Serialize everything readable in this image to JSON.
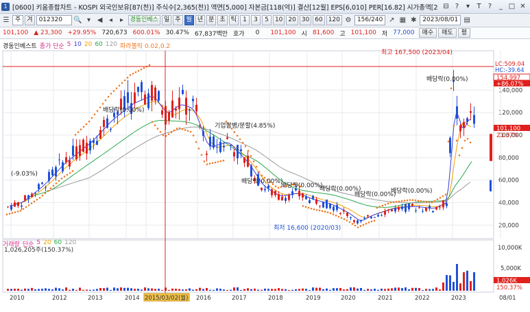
{
  "window": {
    "title": "[0600] 키움종합차트 - KOSPI 외국인보유[87(천)] 주식수[2,365(천)] 액면[5,000] 자본금[118(억)] 결산[12월] EPS[6,010] PER[16.82] 시가총액[2",
    "icon_label": "1",
    "buttons": [
      "⊟",
      "?",
      "▾",
      "T",
      "?",
      "_",
      "□",
      "✕"
    ]
  },
  "toolbar": {
    "market": "주",
    "mode": "겨",
    "code": "012320",
    "company": "경동인베스",
    "period_buttons": [
      "일",
      "주",
      "월",
      "년",
      "분",
      "초",
      "틱"
    ],
    "active_period": "월",
    "interval_buttons": [
      "1",
      "3",
      "5",
      "10",
      "20",
      "30",
      "60",
      "120"
    ],
    "page_count": "156/240",
    "date": "2023/08/01"
  },
  "quote": {
    "price": "101,100",
    "change": "▲ 23,300",
    "change_pct": "+29.95%",
    "volume": "720,673",
    "vol_ratio": "600.01%",
    "turnover": "30.47%",
    "amount": "67,837백만",
    "hoga_label": "호가",
    "hoga_value": "0",
    "hoga_price": "101,100",
    "open_label": "시",
    "open": "81,600",
    "high_label": "고",
    "high": "101,100",
    "low_label": "저",
    "low": "77,000",
    "buy_button": "매수",
    "sell_button": "매도",
    "avg_button": "평"
  },
  "chart_data": {
    "type": "candlestick",
    "title": "경동인베스트",
    "indicators": {
      "ma_label": "종가 단순",
      "ma_periods": [
        "5",
        "10",
        "20",
        "60",
        "120"
      ],
      "ma_colors": [
        "#d42c8a",
        "#3b3bd8",
        "#f0a000",
        "#29a84a",
        "#9a9a9a"
      ],
      "parabolic": "파라볼릭 0.02,0.2"
    },
    "y_axis": {
      "ticks": [
        20000,
        40000,
        60000,
        80000,
        100000,
        120000,
        140000
      ],
      "tick_labels": [
        "20,000",
        "40,000",
        "60,000",
        "80,000",
        "100,000",
        "120,000",
        "140,000"
      ],
      "ylim": [
        8000,
        175000
      ]
    },
    "x_axis": {
      "tick_labels": [
        "2010",
        "2012",
        "2013",
        "2014",
        "2015/03/02(월)",
        "2016",
        "2017",
        "2018",
        "2019",
        "2020",
        "2021",
        "2022",
        "2023",
        "08/01"
      ]
    },
    "price_labels": {
      "lc": "LC:509.04",
      "hc": "HC:-39.64",
      "ref_price": "154,997",
      "ref_pct": "+86.07%",
      "cur_price": "101,100",
      "cur_pct": "21.37%"
    },
    "annotations": {
      "high": "최고 167,500 (2023/04)",
      "low": "최저 16,600 (2020/03)",
      "left": "(-9.03%)",
      "merge": "기업합병/분할(4.85%)",
      "dividend": [
        "배당락(0.00%)",
        "배당락(0.00%)",
        "배당락(0.00%)",
        "배당락(0.00%)",
        "배당락(0.00%)",
        "배당락(0.00%)",
        "배당락(0.00%)"
      ]
    },
    "volume_panel": {
      "label": "거래량",
      "ma_label": "단순",
      "ma_periods": [
        "5",
        "20",
        "60",
        "120"
      ],
      "ma_colors": [
        "#d42c8a",
        "#f0a000",
        "#29a84a",
        "#9a9a9a"
      ],
      "value_text": "1,026,205주(150.37%)",
      "ticks": [
        "5,000K",
        "10,000K"
      ],
      "cur_label": "1,026K",
      "cur_pct": "150.37%"
    }
  },
  "colors": {
    "up": "#e0201c",
    "down": "#1f50d8",
    "parabolic": "#f07820",
    "grid": "#e6e9ee"
  }
}
